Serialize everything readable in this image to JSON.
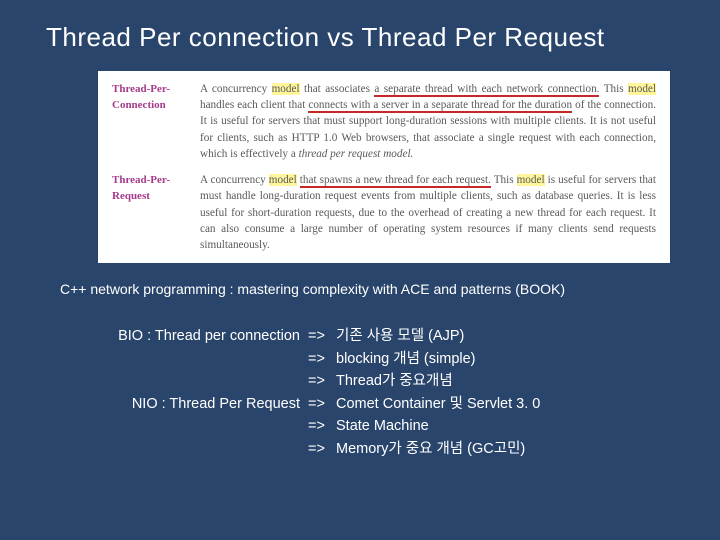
{
  "title": "Thread Per connection vs Thread Per Request",
  "excerpt": {
    "rows": [
      {
        "term": "Thread-Per-Connection",
        "plain1": "A concurrency ",
        "hl1": "model",
        "plain2": " that associates ",
        "u1": "a separate thread with each network connection.",
        "plain3": " This ",
        "hl2": "model",
        "plain4": " handles each client that ",
        "u2": "connects with a server in a separate thread for the duration",
        "rest": " of the connection. It is useful for servers that must support long-duration sessions with multiple clients. It is not useful for clients, such as HTTP 1.0 Web browsers, that associate a single request with each connection, which is effectively a ",
        "tail_italic": "thread per request model."
      },
      {
        "term": "Thread-Per-Request",
        "plain1": "A concurrency ",
        "hl1": "model",
        "plain2": " ",
        "u1": "that spawns a new thread for each request.",
        "plain3": " This ",
        "hl2": "model",
        "rest2": " is useful for servers that must handle long-duration request events from multiple clients, such as database queries. It is less useful for short-duration requests, due to the overhead of creating a new thread for each request. It can also consume a large number of operating system resources if many clients send requests simultaneously."
      }
    ]
  },
  "caption": "C++ network programming : mastering complexity with ACE and patterns (BOOK)",
  "notes": {
    "bio_label": "BIO : Thread per connection",
    "nio_label": "NIO : Thread Per Request",
    "arrow": "=>",
    "bio_lines": [
      "기존 사용 모델 (AJP)",
      "blocking 개념 (simple)",
      "Thread가 중요개념"
    ],
    "nio_lines": [
      "Comet Container 및 Servlet 3. 0",
      "State Machine",
      "Memory가 중요 개념 (GC고민)"
    ]
  }
}
